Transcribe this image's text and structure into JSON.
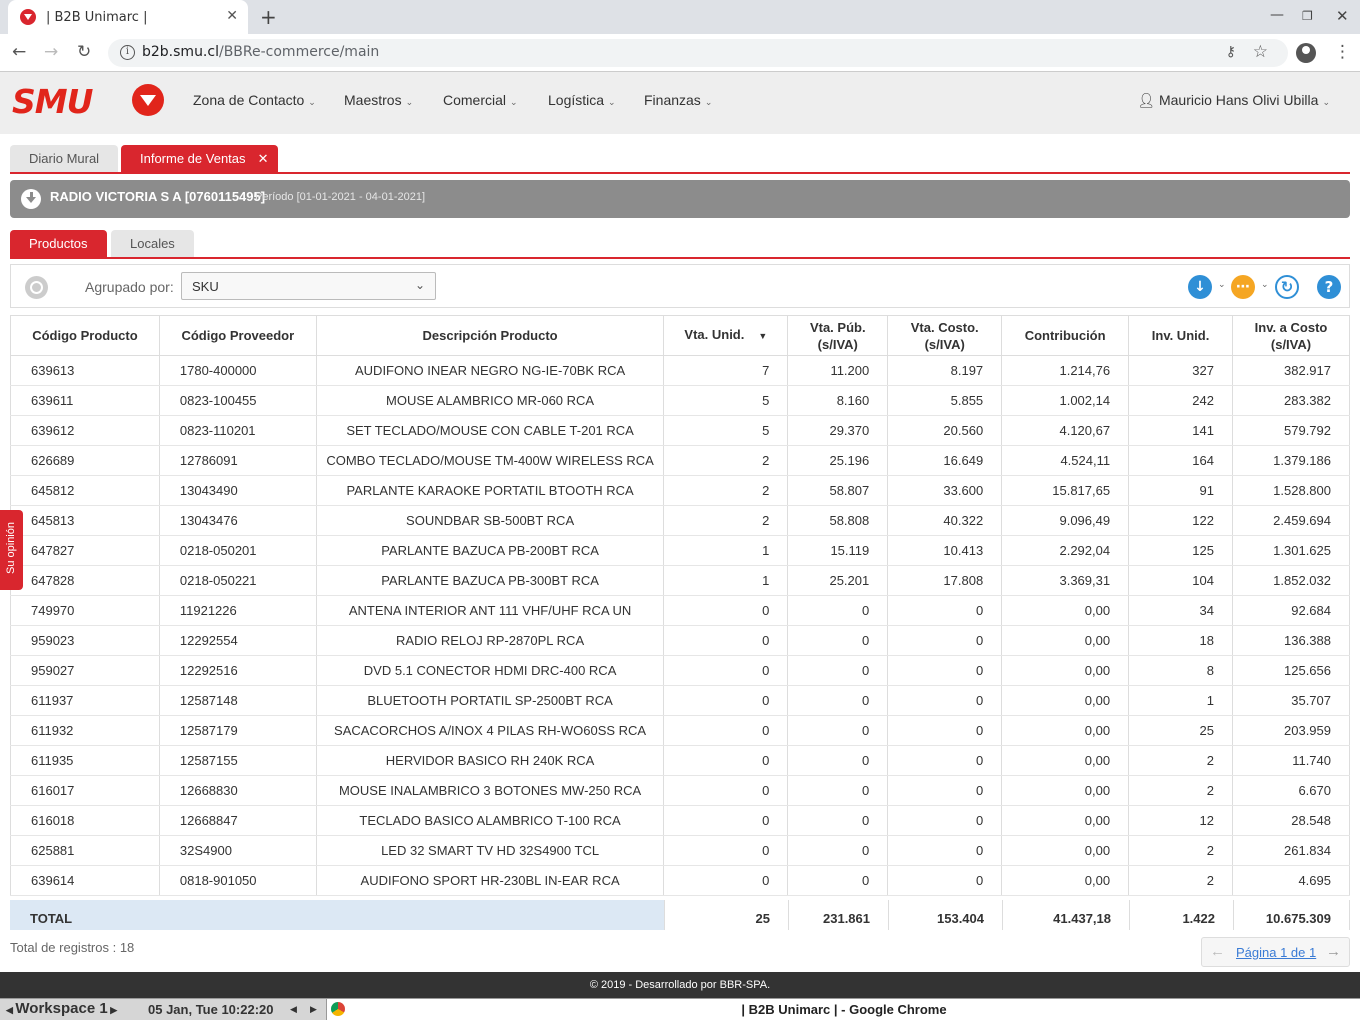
{
  "browser": {
    "tab_title": "| B2B Unimarc |",
    "url_host": "b2b.smu.cl",
    "url_path": "/BBRe-commerce/main"
  },
  "header": {
    "logo_text": "SMU",
    "menu": [
      {
        "label": "Zona de Contacto"
      },
      {
        "label": "Maestros"
      },
      {
        "label": "Comercial"
      },
      {
        "label": "Logística"
      },
      {
        "label": "Finanzas"
      }
    ],
    "user_name": "Mauricio Hans Olivi Ubilla"
  },
  "page_tabs": [
    {
      "label": "Diario Mural",
      "active": false
    },
    {
      "label": "Informe de Ventas",
      "active": true
    }
  ],
  "banner": {
    "provider": "RADIO VICTORIA S A [0760115495]",
    "period": "Período [01-01-2021 - 04-01-2021]"
  },
  "sub_tabs": [
    {
      "label": "Productos",
      "active": true
    },
    {
      "label": "Locales",
      "active": false
    }
  ],
  "toolbar": {
    "group_label": "Agrupado por:",
    "group_value": "SKU"
  },
  "table": {
    "columns": [
      "Código Producto",
      "Código Proveedor",
      "Descripción Producto",
      "Vta. Unid.",
      "Vta. Púb. (s/IVA)",
      "Vta. Costo. (s/IVA)",
      "Contribución",
      "Inv. Unid.",
      "Inv. a Costo (s/IVA)"
    ],
    "rows": [
      [
        "639613",
        "1780-400000",
        "AUDIFONO INEAR NEGRO NG-IE-70BK RCA",
        "7",
        "11.200",
        "8.197",
        "1.214,76",
        "327",
        "382.917"
      ],
      [
        "639611",
        "0823-100455",
        "MOUSE ALAMBRICO MR-060 RCA",
        "5",
        "8.160",
        "5.855",
        "1.002,14",
        "242",
        "283.382"
      ],
      [
        "639612",
        "0823-110201",
        "SET TECLADO/MOUSE CON CABLE T-201 RCA",
        "5",
        "29.370",
        "20.560",
        "4.120,67",
        "141",
        "579.792"
      ],
      [
        "626689",
        "12786091",
        "COMBO TECLADO/MOUSE TM-400W WIRELESS RCA",
        "2",
        "25.196",
        "16.649",
        "4.524,11",
        "164",
        "1.379.186"
      ],
      [
        "645812",
        "13043490",
        "PARLANTE KARAOKE PORTATIL BTOOTH RCA",
        "2",
        "58.807",
        "33.600",
        "15.817,65",
        "91",
        "1.528.800"
      ],
      [
        "645813",
        "13043476",
        "SOUNDBAR SB-500BT RCA",
        "2",
        "58.808",
        "40.322",
        "9.096,49",
        "122",
        "2.459.694"
      ],
      [
        "647827",
        "0218-050201",
        "PARLANTE BAZUCA PB-200BT RCA",
        "1",
        "15.119",
        "10.413",
        "2.292,04",
        "125",
        "1.301.625"
      ],
      [
        "647828",
        "0218-050221",
        "PARLANTE BAZUCA PB-300BT RCA",
        "1",
        "25.201",
        "17.808",
        "3.369,31",
        "104",
        "1.852.032"
      ],
      [
        "749970",
        "11921226",
        "ANTENA INTERIOR ANT 111 VHF/UHF RCA UN",
        "0",
        "0",
        "0",
        "0,00",
        "34",
        "92.684"
      ],
      [
        "959023",
        "12292554",
        "RADIO RELOJ RP-2870PL RCA",
        "0",
        "0",
        "0",
        "0,00",
        "18",
        "136.388"
      ],
      [
        "959027",
        "12292516",
        "DVD 5.1 CONECTOR HDMI DRC-400 RCA",
        "0",
        "0",
        "0",
        "0,00",
        "8",
        "125.656"
      ],
      [
        "611937",
        "12587148",
        "BLUETOOTH PORTATIL SP-2500BT RCA",
        "0",
        "0",
        "0",
        "0,00",
        "1",
        "35.707"
      ],
      [
        "611932",
        "12587179",
        "SACACORCHOS A/INOX 4 PILAS RH-WO60SS RCA",
        "0",
        "0",
        "0",
        "0,00",
        "25",
        "203.959"
      ],
      [
        "611935",
        "12587155",
        "HERVIDOR BASICO RH 240K RCA",
        "0",
        "0",
        "0",
        "0,00",
        "2",
        "11.740"
      ],
      [
        "616017",
        "12668830",
        "MOUSE INALAMBRICO 3 BOTONES MW-250 RCA",
        "0",
        "0",
        "0",
        "0,00",
        "2",
        "6.670"
      ],
      [
        "616018",
        "12668847",
        "TECLADO BASICO ALAMBRICO T-100 RCA",
        "0",
        "0",
        "0",
        "0,00",
        "12",
        "28.548"
      ],
      [
        "625881",
        "32S4900",
        "LED 32 SMART TV HD 32S4900 TCL",
        "0",
        "0",
        "0",
        "0,00",
        "2",
        "261.834"
      ],
      [
        "639614",
        "0818-901050",
        "AUDIFONO SPORT HR-230BL IN-EAR RCA",
        "0",
        "0",
        "0",
        "0,00",
        "2",
        "4.695"
      ]
    ],
    "totals": {
      "label": "TOTAL",
      "vta_unid": "25",
      "vta_pub": "231.861",
      "vta_costo": "153.404",
      "contribucion": "41.437,18",
      "inv_unid": "1.422",
      "inv_costo": "10.675.309"
    }
  },
  "record_count": "Total de registros : 18",
  "pager_label": "Página 1 de 1",
  "feedback_label": "Su opinión",
  "footer_text": "© 2019 - Desarrollado por BBR-SPA.",
  "taskbar": {
    "workspace": "Workspace 1",
    "datetime": "05 Jan, Tue 10:22:20",
    "window_title": "| B2B Unimarc | - Google Chrome"
  },
  "colors": {
    "brand_red": "#e1251b",
    "banner_gray": "#8c8c8c",
    "total_row_bg": "#dce8f4"
  }
}
